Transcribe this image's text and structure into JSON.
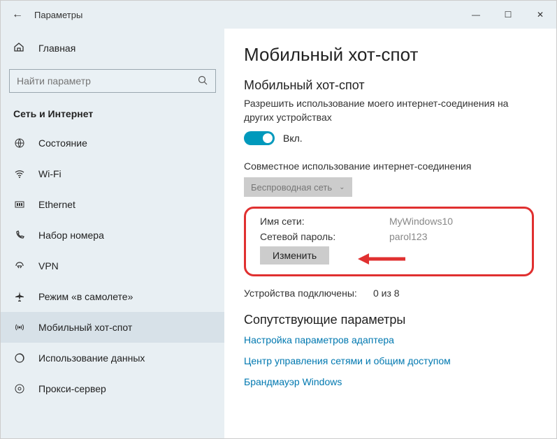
{
  "window": {
    "title": "Параметры"
  },
  "home": {
    "label": "Главная"
  },
  "search": {
    "placeholder": "Найти параметр"
  },
  "category": "Сеть и Интернет",
  "nav": [
    {
      "label": "Состояние"
    },
    {
      "label": "Wi-Fi"
    },
    {
      "label": "Ethernet"
    },
    {
      "label": "Набор номера"
    },
    {
      "label": "VPN"
    },
    {
      "label": "Режим «в самолете»"
    },
    {
      "label": "Мобильный хот-спот"
    },
    {
      "label": "Использование данных"
    },
    {
      "label": "Прокси-сервер"
    }
  ],
  "page": {
    "title": "Мобильный хот-спот",
    "section_title": "Мобильный хот-спот",
    "desc": "Разрешить использование моего интернет-соединения на других устройствах",
    "toggle_state": "Вкл.",
    "share_label": "Совместное использование интернет-соединения",
    "share_value": "Беспроводная сеть",
    "net_name_label": "Имя сети:",
    "net_name_value": "MyWindows10",
    "net_pass_label": "Сетевой пароль:",
    "net_pass_value": "parol123",
    "edit_btn": "Изменить",
    "devices_label": "Устройства подключены:",
    "devices_value": "0 из 8",
    "related_title": "Сопутствующие параметры",
    "links": [
      "Настройка параметров адаптера",
      "Центр управления сетями и общим доступом",
      "Брандмауэр Windows"
    ]
  }
}
